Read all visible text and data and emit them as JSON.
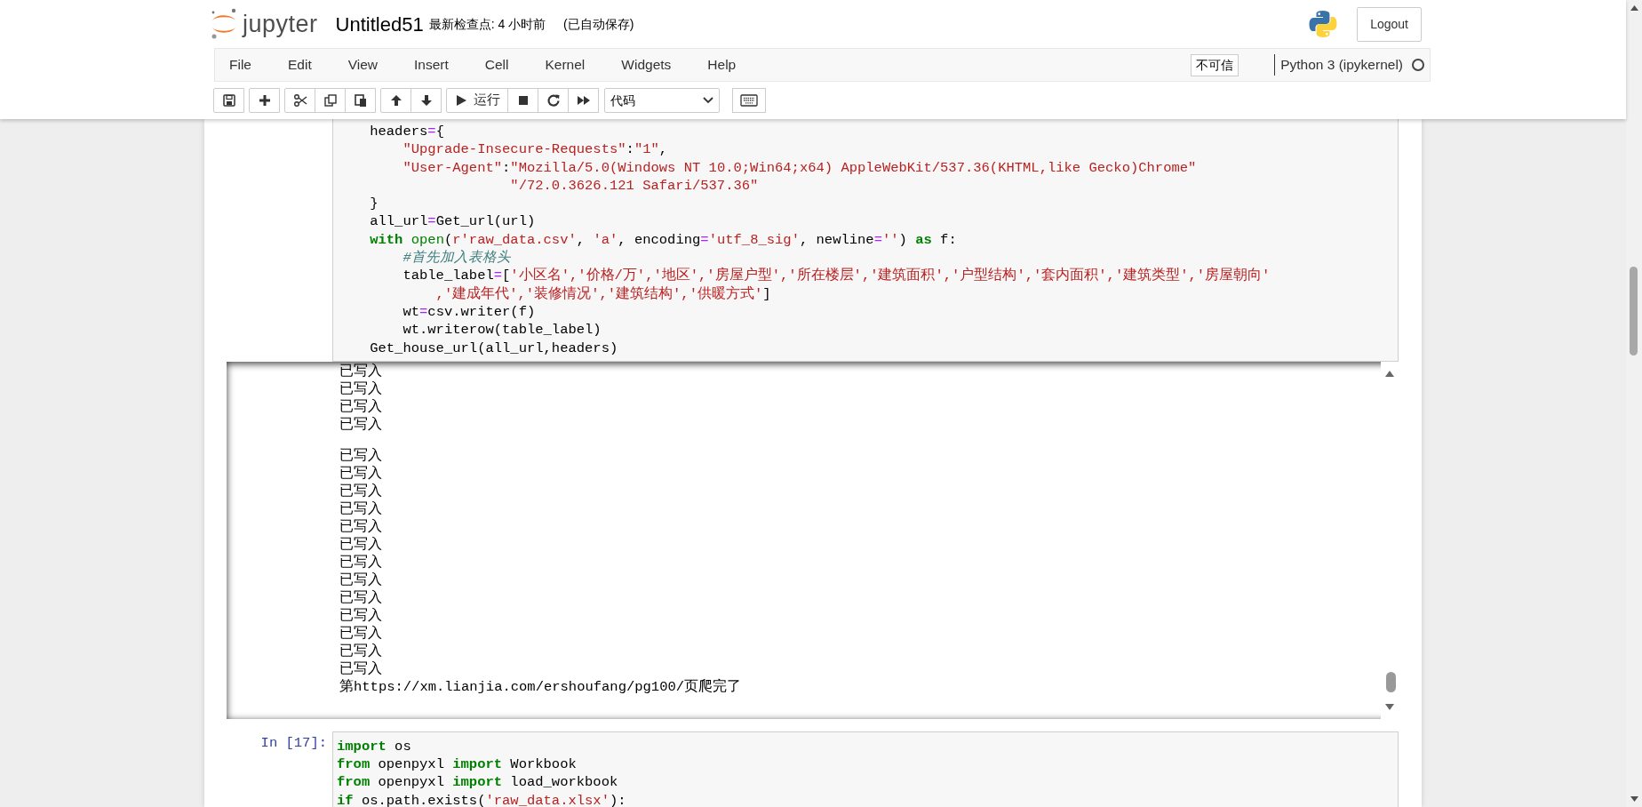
{
  "header": {
    "logo_text": "jupyter",
    "notebook_name": "Untitled51",
    "checkpoint": "最新检查点: 4 小时前",
    "autosave": "(已自动保存)",
    "logout": "Logout"
  },
  "menu": [
    "File",
    "Edit",
    "View",
    "Insert",
    "Cell",
    "Kernel",
    "Widgets",
    "Help"
  ],
  "trust": "不可信",
  "kernel": {
    "name": "Python 3 (ipykernel)",
    "busy": false
  },
  "toolbar": [
    [
      {
        "kind": "save"
      }
    ],
    [
      {
        "kind": "add"
      }
    ],
    [
      {
        "kind": "cut"
      },
      {
        "kind": "copy"
      },
      {
        "kind": "paste"
      }
    ],
    [
      {
        "kind": "up"
      },
      {
        "kind": "down"
      }
    ],
    [
      {
        "kind": "run",
        "label": "运行"
      },
      {
        "kind": "stop"
      },
      {
        "kind": "restart"
      },
      {
        "kind": "fastforward"
      }
    ]
  ],
  "cell_type": "代码",
  "cells": [
    {
      "lines": [
        [
          {
            "kind": "plain",
            "text": "    headers"
          },
          {
            "kind": "op",
            "text": "="
          },
          {
            "kind": "plain",
            "text": "{"
          }
        ],
        [
          {
            "kind": "string",
            "text": "        \"Upgrade-Insecure-Requests\""
          },
          {
            "kind": "plain",
            "text": ":"
          },
          {
            "kind": "string",
            "text": "\"1\""
          },
          {
            "kind": "plain",
            "text": ","
          }
        ],
        [
          {
            "kind": "string",
            "text": "        \"User-Agent\""
          },
          {
            "kind": "plain",
            "text": ":"
          },
          {
            "kind": "string",
            "text": "\"Mozilla/5.0(Windows NT 10.0;Win64;x64) AppleWebKit/537.36(KHTML,like Gecko)Chrome\""
          }
        ],
        [
          {
            "kind": "string",
            "text": "                     \"/72.0.3626.121 Safari/537.36\""
          }
        ],
        [
          {
            "kind": "plain",
            "text": "    }"
          }
        ],
        [
          {
            "kind": "plain",
            "text": "    all_url"
          },
          {
            "kind": "op",
            "text": "="
          },
          {
            "kind": "plain",
            "text": "Get_url(url)"
          }
        ],
        [
          {
            "kind": "keyword",
            "text": "    with"
          },
          {
            "kind": "builtin",
            "text": " open"
          },
          {
            "kind": "plain",
            "text": "("
          },
          {
            "kind": "string",
            "text": "r'raw_data.csv'"
          },
          {
            "kind": "plain",
            "text": ", "
          },
          {
            "kind": "string",
            "text": "'a'"
          },
          {
            "kind": "plain",
            "text": ", encoding"
          },
          {
            "kind": "op",
            "text": "="
          },
          {
            "kind": "string",
            "text": "'utf_8_sig'"
          },
          {
            "kind": "plain",
            "text": ", newline"
          },
          {
            "kind": "op",
            "text": "="
          },
          {
            "kind": "string",
            "text": "''"
          },
          {
            "kind": "plain",
            "text": ") "
          },
          {
            "kind": "keyword",
            "text": "as"
          },
          {
            "kind": "plain",
            "text": " f:"
          }
        ],
        [
          {
            "kind": "comment",
            "text": "        #首先加入表格头"
          }
        ],
        [
          {
            "kind": "plain",
            "text": "        table_label"
          },
          {
            "kind": "op",
            "text": "="
          },
          {
            "kind": "plain",
            "text": "["
          },
          {
            "kind": "string",
            "text": "'小区名','价格/万','地区','房屋户型','所在楼层','建筑面积','户型结构','套内面积','建筑类型','房屋朝向'"
          }
        ],
        [
          {
            "kind": "string",
            "text": "            ,'建成年代','装修情况','建筑结构','供暖方式'"
          },
          {
            "kind": "plain",
            "text": "]"
          }
        ],
        [
          {
            "kind": "plain",
            "text": "        wt"
          },
          {
            "kind": "op",
            "text": "="
          },
          {
            "kind": "plain",
            "text": "csv.writer(f)"
          }
        ],
        [
          {
            "kind": "plain",
            "text": "        wt.writerow(table_label)"
          }
        ],
        [
          {
            "kind": "plain",
            "text": "    Get_house_url(all_url,headers)"
          }
        ]
      ],
      "output": [
        {
          "kind": "line",
          "text": "已写入"
        },
        {
          "kind": "line",
          "text": "已写入"
        },
        {
          "kind": "line",
          "text": "已写入"
        },
        {
          "kind": "line",
          "text": "已写入"
        },
        {
          "kind": "blank"
        },
        {
          "kind": "line",
          "text": "已写入"
        },
        {
          "kind": "line",
          "text": "已写入"
        },
        {
          "kind": "line",
          "text": "已写入"
        },
        {
          "kind": "line",
          "text": "已写入"
        },
        {
          "kind": "line",
          "text": "已写入"
        },
        {
          "kind": "line",
          "text": "已写入"
        },
        {
          "kind": "line",
          "text": "已写入"
        },
        {
          "kind": "line",
          "text": "已写入"
        },
        {
          "kind": "line",
          "text": "已写入"
        },
        {
          "kind": "line",
          "text": "已写入"
        },
        {
          "kind": "line",
          "text": "已写入"
        },
        {
          "kind": "line",
          "text": "已写入"
        },
        {
          "kind": "line",
          "text": "已写入"
        },
        {
          "kind": "line",
          "text": "第https://xm.lianjia.com/ershoufang/pg100/页爬完了"
        }
      ]
    },
    {
      "prompt": "In [17]:",
      "lines": [
        [
          {
            "kind": "keyword",
            "text": "import"
          },
          {
            "kind": "plain",
            "text": " os"
          }
        ],
        [
          {
            "kind": "keyword",
            "text": "from"
          },
          {
            "kind": "plain",
            "text": " openpyxl "
          },
          {
            "kind": "keyword",
            "text": "import"
          },
          {
            "kind": "plain",
            "text": " Workbook"
          }
        ],
        [
          {
            "kind": "keyword",
            "text": "from"
          },
          {
            "kind": "plain",
            "text": " openpyxl "
          },
          {
            "kind": "keyword",
            "text": "import"
          },
          {
            "kind": "plain",
            "text": " load_workbook"
          }
        ],
        [
          {
            "kind": "keyword",
            "text": "if"
          },
          {
            "kind": "plain",
            "text": " os.path.exists("
          },
          {
            "kind": "string",
            "text": "'raw_data.xlsx'"
          },
          {
            "kind": "plain",
            "text": "):"
          }
        ]
      ]
    }
  ]
}
